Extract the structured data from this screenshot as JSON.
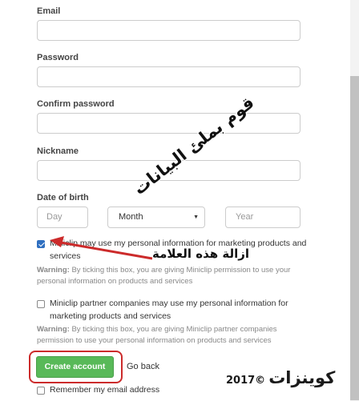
{
  "form": {
    "email_label": "Email",
    "email_value": "",
    "password_label": "Password",
    "password_value": "",
    "confirm_label": "Confirm password",
    "confirm_value": "",
    "nickname_label": "Nickname",
    "nickname_value": "",
    "dob_label": "Date of birth",
    "dob_day_placeholder": "Day",
    "dob_month_value": "Month",
    "dob_year_placeholder": "Year"
  },
  "options": {
    "marketing_text": "Miniclip may use my personal information for marketing products and services",
    "marketing_checked": true,
    "warning_prefix": "Warning:",
    "marketing_warning": "By ticking this box, you are giving Miniclip permission to use your personal information on products and services",
    "partner_text": "Miniclip partner companies may use my personal information for marketing products and services",
    "partner_checked": false,
    "partner_warning": "By ticking this box, you are giving Miniclip partner companies permission to use your personal information on products and services",
    "remember_text": "Remember my email address",
    "remember_checked": false
  },
  "actions": {
    "create_label": "Create account",
    "go_back_label": "Go back"
  },
  "annotations": {
    "fill_data_text": "قوم بملئ البيانات",
    "remove_mark_text": "ازالة هذه العلامة",
    "arrow_color": "#cc2b2b",
    "highlight_color": "#cc2b2b"
  },
  "watermark": {
    "year": "2017©",
    "brand": "كوينزات"
  },
  "colors": {
    "create_button": "#58b958",
    "checkbox_checked": "#2f6fc0"
  }
}
